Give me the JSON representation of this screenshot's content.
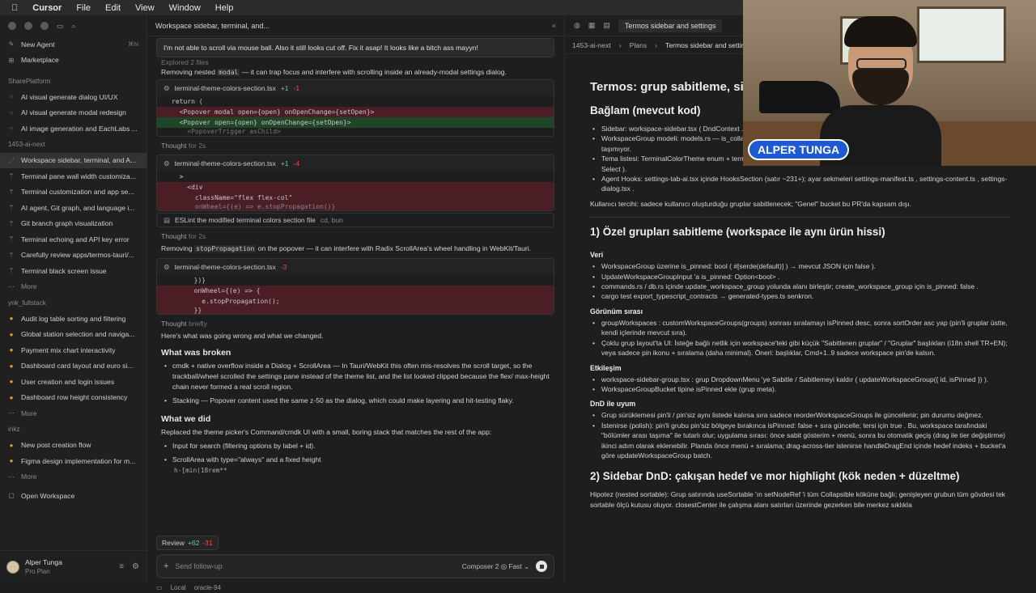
{
  "menubar": {
    "app": "Cursor",
    "items": [
      "File",
      "Edit",
      "View",
      "Window",
      "Help"
    ]
  },
  "sidebar": {
    "new_agent": "New Agent",
    "new_agent_hint": "⌘N",
    "marketplace": "Marketplace",
    "groups": [
      {
        "title": "SharePlatform",
        "items": [
          "AI visual generate dialog UI/UX",
          "AI visual generate modal redesign",
          "AI image generation and EachLabs ..."
        ]
      },
      {
        "title": "1453-ai-next",
        "items": [
          "Workspace sidebar, terminal, and A...",
          "Terminal pane wall width customiza...",
          "Terminal customization and app se...",
          "AI agent, Git graph, and language i...",
          "Git branch graph visualization",
          "Terminal echoing and API key error",
          "Carefully review apps/termos-tauri/...",
          "Terminal black screen issue"
        ],
        "more": "More"
      },
      {
        "title": "ynk_fullstack",
        "items": [
          "Audit log table sorting and filtering",
          "Global station selection and naviga...",
          "Payment mix chart interactivity",
          "Dashboard card layout and euro si...",
          "User creation and login issues",
          "Dashboard row height consistency"
        ],
        "more": "More"
      },
      {
        "title": "inkz",
        "items": [
          "New post creation flow",
          "Figma design implementation for m..."
        ],
        "more": "More"
      }
    ],
    "open_workspace": "Open Workspace",
    "user_name": "Alper Tunga",
    "user_plan": "Pro Plan"
  },
  "chat": {
    "tab_title": "Workspace sidebar, terminal, and...",
    "user_msg": "I'm not able to scroll via mouse ball. Also it still looks cut off. Fix it asap! It looks like a bitch ass mayyn!",
    "explored": "Explored 2 files",
    "p1_a": "Removing nested ",
    "p1_code": "modal",
    "p1_b": " — it can trap focus and interfere with scrolling inside an already-modal settings dialog.",
    "file1": "terminal-theme-colors-section.tsx",
    "file1_add": "+1",
    "file1_del": "-1",
    "code1": [
      "return (",
      "  <Popover modal open={open} onOpenChange={setOpen}>",
      "  <Popover open={open} onOpenChange={setOpen}>",
      "    <PopoverTrigger asChild>"
    ],
    "thought1": "Thought",
    "thought1_t": "for 2s",
    "file2": "terminal-theme-colors-section.tsx",
    "file2_add": "+1",
    "file2_del": "-4",
    "code2": [
      "  >",
      "    <div",
      "      className=\"flex flex-col\"",
      "      onWheel={(e) => e.stopPropagation()}"
    ],
    "lint": "ESLint the modified terminal colors section file",
    "lint_sub": "cd, bun",
    "thought2": "Thought",
    "thought2_t": "for 2s",
    "p2_a": "Removing ",
    "p2_code": "stopPropagation",
    "p2_b": " on the popover — it can interfere with Radix ScrollArea's wheel handling in WebKit/Tauri.",
    "file3": "terminal-theme-colors-section.tsx",
    "file3_del": "-3",
    "code3": [
      "  })}",
      "  onWheel={(e) => {",
      "    e.stopPropagation();",
      "  }}"
    ],
    "thought3": "Thought",
    "thought3_t": "briefly",
    "p3": "Here's what was going wrong and what we changed.",
    "h_broken": "What was broken",
    "b1": "cmdk + native overflow inside a Dialog + ScrollArea — In Tauri/WebKit this often mis-resolves the scroll target, so the trackball/wheel scrolled the settings pane instead of the theme list, and the list looked clipped because the flex/ max-height chain never formed a real scroll region.",
    "b2": "Stacking — Popover content used the same z-50 as the dialog, which could make layering and hit-testing flaky.",
    "h_did": "What we did",
    "p4": "Replaced the theme picker's Command/cmdk UI with a small, boring stack that matches the rest of the app:",
    "d1": "Input for search (filtering options by label + id).",
    "d2": "ScrollArea with type=\"always\" and a fixed height",
    "d3": "h-[min(18rem**",
    "review": "Review",
    "review_add": "+62",
    "review_del": "-31",
    "composer_placeholder": "Send follow-up",
    "composer_model": "Composer 2 ◎ Fast ⌄",
    "status_local": "Local",
    "status_branch": "oracle-94"
  },
  "doc": {
    "tab": "Termos sidebar and settings",
    "crumbs": [
      "1453-ai-next",
      "Plans",
      "Termos sidebar and settings"
    ],
    "title": "Termos: grup sabitleme, sidebar DnD ve tema ayarları",
    "h_context": "Bağlam (mevcut kod)",
    "ctx1": "Sidebar: workspace-sidebar.tsx ( DndContext ... ) ve workspace-sidebar-group.tsx , çalışma alanı satırı workspace-sidebar-row.tsx .",
    "ctx2": "WorkspaceGroup modeli: models.rs — is_collapsed ve sort_order var; UpdateWorkspaceGroupInput şu an is_collapsed dışında pin taşımıyor.",
    "ctx3": "Tema listesi: TerminalColorTheme enum + terminal-themes.ts içindeki THEMES haritası + UI terminal-theme-colors-section.tsx ( Select ).",
    "ctx4": "Agent Hooks: settings-tab-ai.tsx içinde HooksSection (satır ~231+); ayar sekmeleri settings-manifest.ts , settings-content.ts , settings-dialog.tsx .",
    "pref": "Kullanıcı tercihi: sadece kullanıcı oluşturduğu gruplar sabitlenecek; \"Genel\" bucket bu PR'da kapsam dışı.",
    "h1": "1) Özel grupları sabitleme (workspace ile aynı ürün hissi)",
    "veri": "Veri",
    "v1": "WorkspaceGroup üzerine is_pinned: bool ( #[serde(default)] ) → mevcut JSON için false ).",
    "v2": "UpdateWorkspaceGroupInput 'a is_pinned: Option<bool> .",
    "v3": "commands.rs / db.rs içinde update_workspace_group yolunda alanı birleştir; create_workspace_group için is_pinned: false .",
    "v4": "cargo test export_typescript_contracts → generated-types.ts senkron.",
    "gorunum": "Görünüm sırası",
    "g1": "groupWorkspaces : customWorkspaceGroups(groups) sonrası sıralamayı isPinned desc, sonra sortOrder asc yap (pin'li gruplar üstte, kendi içlerinde mevcut sıra).",
    "g2": "Çoklu grup layout'ta UI: İsteğe bağlı netlik için workspace'teki gibi küçük \"Sabitlenen gruplar\" / \"Gruplar\" başlıkları (i18n shell TR+EN); veya sadece pin ikonu + sıralama (daha minimal). Öneri: başlıklar, Cmd+1..9 sadece workspace pin'de kalsın.",
    "etkilesim": "Etkileşim",
    "e1": "workspace-sidebar-group.tsx : grup DropdownMenu 'ye Sabitle / Sabitlemeyi kaldır ( updateWorkspaceGroup({ id, isPinned }) ).",
    "e2": "WorkspaceGroupBucket tipine isPinned ekle (grup meta).",
    "dnd": "DnD ile uyum",
    "n1": "Grup sürüklemesi pin'li / pin'siz aynı listede kalırsa sıra sadece reorderWorkspaceGroups ile güncellenir; pin durumu değmez.",
    "n2": "İstenirse (polish): pin'li grubu pin'siz bölgeye bırakınca isPinned: false + sıra güncelle; tersi için true . Bu, workspace tarafındaki \"bölümler arası taşıma\" ile tutarlı olur; uygulama sırası: önce sabit gösterim + menü, sonra bu otomatik geçiş (drag ile tier değiştirme) ikinci adım olarak eklenebilir. Planda önce menü + sıralama; drag-across-tier istenirse handleDragEnd içinde hedef indeks + bucket'a göre updateWorkspaceGroup batch.",
    "h2": "2) Sidebar DnD: çakışan hedef ve mor highlight (kök neden + düzeltme)",
    "h2p": "Hipotez (nested sortable): Grup satırında useSortable 'ın setNodeRef 'i tüm Collapsible köküne bağlı; genişleyen grubun tüm gövdesi tek sortable ölçü kutusu oluyor. closestCenter ile çalışma alanı satırları üzerinde gezerken bile merkez sıklıkla"
  },
  "cam": {
    "name": "ALPER TUNGA"
  }
}
